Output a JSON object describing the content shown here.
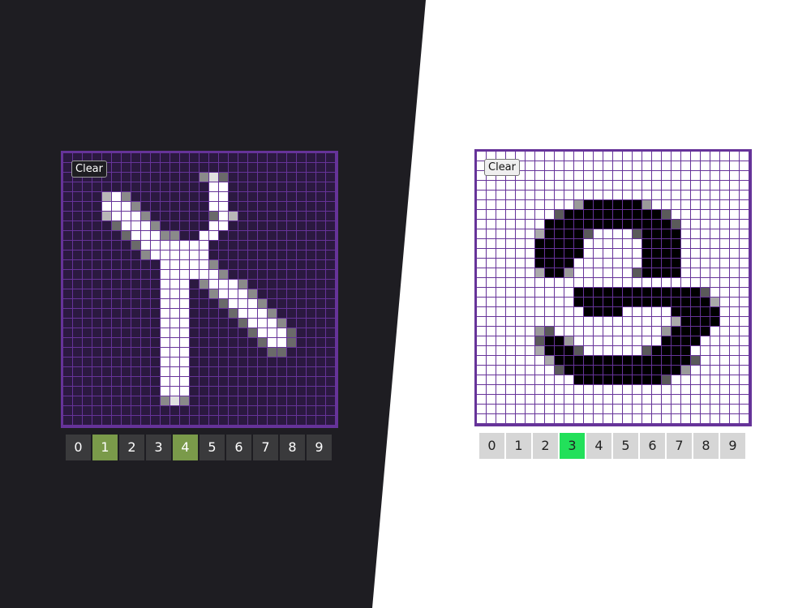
{
  "panels": {
    "dark": {
      "clear_label": "Clear",
      "digits": [
        "0",
        "1",
        "2",
        "3",
        "4",
        "5",
        "6",
        "7",
        "8",
        "9"
      ],
      "highlighted_digits": [
        1,
        4
      ],
      "highlight_color": "#7a9a4a",
      "background": "#1e1d22",
      "cell_color": "#2b1940",
      "grid_color": "#663399",
      "drawing": [
        "............................",
        "............................",
        "..............aCb...........",
        "...............WW...........",
        "....cWa........WW...........",
        "....WWWa.......WW...........",
        "....cWWWa......bWc..........",
        ".....bWWWa.....WW...........",
        "......bWWWaa..WW............",
        ".......bWWWWWWW.............",
        "........aWWWWWW.............",
        "..........WWWWWa............",
        "..........WWWWWWa...........",
        "..........WWW.aWWWa.........",
        "..........WWW..aWWWa........",
        "..........WWW...bWWWa.......",
        "..........WWW....bWWWa......",
        "..........WWW.....bWWWa.....",
        "..........WWW......bWWWb....",
        "..........WWW.......bWWb....",
        "..........WWW........bb.....",
        "..........WWW...............",
        "..........WWW...............",
        "..........WWW...............",
        "..........WWW...............",
        "..........aCa...............",
        "............................",
        "............................"
      ]
    },
    "light": {
      "clear_label": "Clear",
      "digits": [
        "0",
        "1",
        "2",
        "3",
        "4",
        "5",
        "6",
        "7",
        "8",
        "9"
      ],
      "highlighted_digits": [
        3
      ],
      "highlight_color": "#22e05a",
      "background": "#ffffff",
      "cell_color": "#ffffff",
      "grid_color": "#663399",
      "drawing": [
        "............................",
        "............................",
        "............................",
        "............................",
        "............................",
        "..........aKKKKKKa..........",
        "........bKKKKKKKKKKb........",
        ".......KKKKKKKKKKKKKb.......",
        "......cKKKKb....bKKKK.......",
        "......KKKKK......KKKK.......",
        "......KKKKK......KKKK.......",
        "......KKKK.......KKKK.......",
        "......cKKa......bKKKK.......",
        "......................",
        "..........KKKKKKKKKKKKKb....",
        "..........KKKKKKKKKKKKKKc...",
        "...........KKKK.....KKKKK...",
        "....................cKKKK...",
        "......ab...........aKKKK....",
        "......bKKa.........KKKK.....",
        "......cKKKb......bKKKK......",
        ".......cKKKKKKKKKKKKKKb......",
        "........bKKKKKKKKKKKKa......",
        "..........KKKKKKKKKb........",
        "............................",
        "............................",
        "............................",
        "............................"
      ]
    }
  }
}
